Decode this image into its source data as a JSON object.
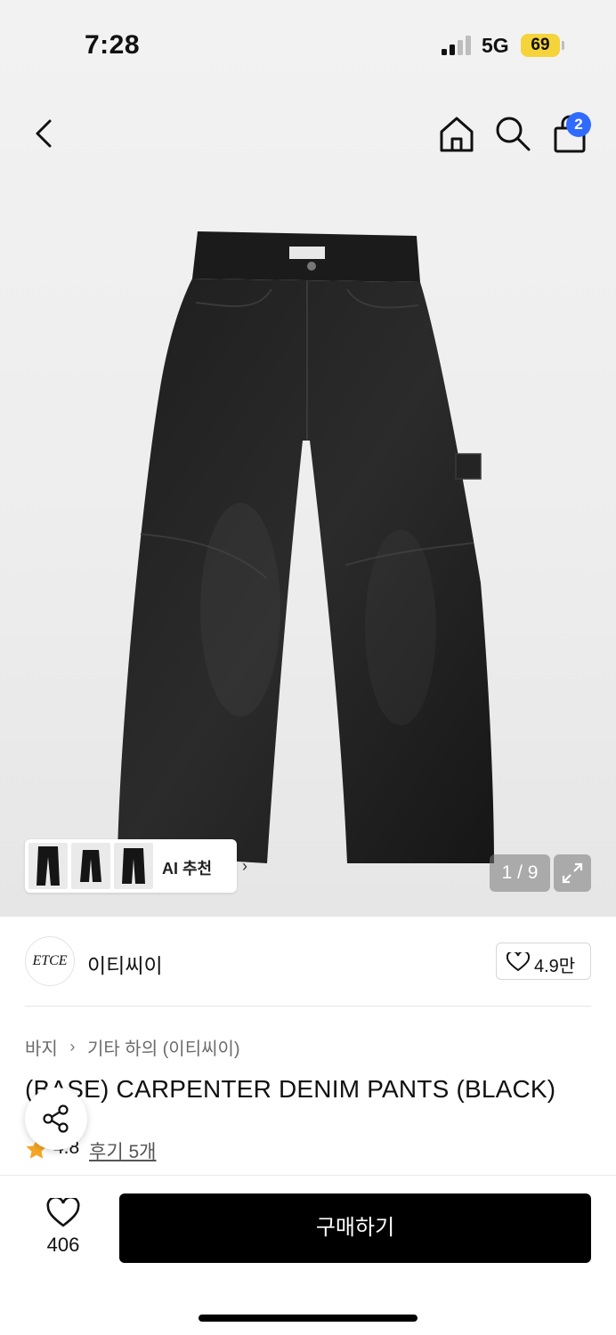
{
  "status_bar": {
    "time": "7:28",
    "network": "5G",
    "battery": "69"
  },
  "header": {
    "cart_count": "2"
  },
  "gallery": {
    "ai_label": "AI 추천",
    "counter": "1 / 9"
  },
  "brand": {
    "logo_text": "ETCE",
    "name": "이티씨이",
    "likes": "4.9만"
  },
  "breadcrumb": {
    "category": "바지",
    "subcategory": "기타 하의 (이티씨이)"
  },
  "product": {
    "title": "(BASE) CARPENTER DENIM PANTS (BLACK)",
    "rating": "4.8",
    "reviews": "후기 5개"
  },
  "bottom_bar": {
    "like_count": "406",
    "buy_label": "구매하기"
  },
  "colors": {
    "buy_button": "#000000",
    "badge": "#2f6bff",
    "star": "#f5a623",
    "battery": "#f5d33a"
  }
}
